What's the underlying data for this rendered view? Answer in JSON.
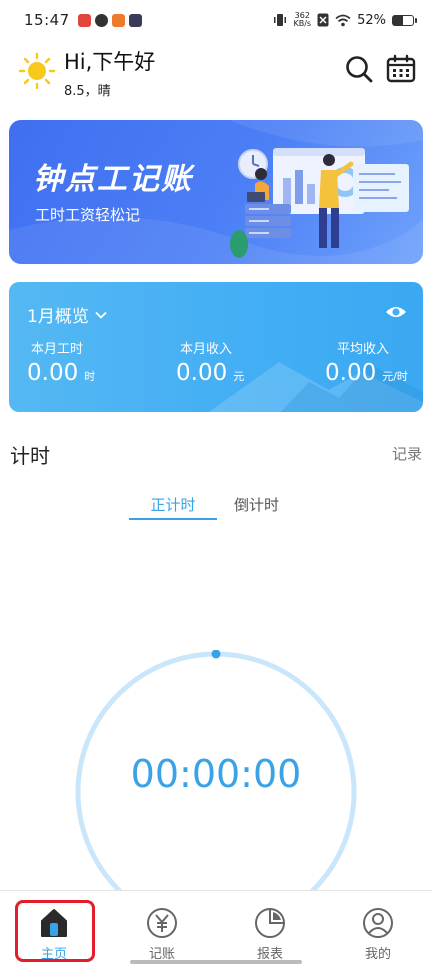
{
  "status_bar": {
    "time": "15:47",
    "net_speed_value": "362",
    "net_speed_unit": "KB/s",
    "battery": "52%",
    "battery_level": 0.52
  },
  "header": {
    "greeting": "Hi,下午好",
    "weather": "8.5，晴",
    "icons": [
      "sun-icon",
      "search-icon",
      "calendar-icon"
    ]
  },
  "banner": {
    "title": "钟点工记账",
    "subtitle": "工时工资轻松记"
  },
  "overview": {
    "month": "1月概览",
    "items": [
      {
        "label": "本月工时",
        "value": "0.00",
        "unit": "时"
      },
      {
        "label": "本月收入",
        "value": "0.00",
        "unit": "元"
      },
      {
        "label": "平均收入",
        "value": "0.00",
        "unit": "元/时"
      }
    ]
  },
  "timer": {
    "section_title": "计时",
    "record_link": "记录",
    "tabs": [
      {
        "label": "正计时",
        "active": true
      },
      {
        "label": "倒计时",
        "active": false
      }
    ],
    "display": "00:00:00"
  },
  "bottom_nav": {
    "items": [
      {
        "label": "主页",
        "icon": "home-icon",
        "active": true
      },
      {
        "label": "记账",
        "icon": "yen-icon",
        "active": false
      },
      {
        "label": "报表",
        "icon": "pie-chart-icon",
        "active": false
      },
      {
        "label": "我的",
        "icon": "user-icon",
        "active": false
      }
    ]
  },
  "colors": {
    "accent": "#3aa3e8",
    "banner": "#4c7ff6",
    "overview": "#42aef4",
    "highlight": "#e31e2a"
  }
}
